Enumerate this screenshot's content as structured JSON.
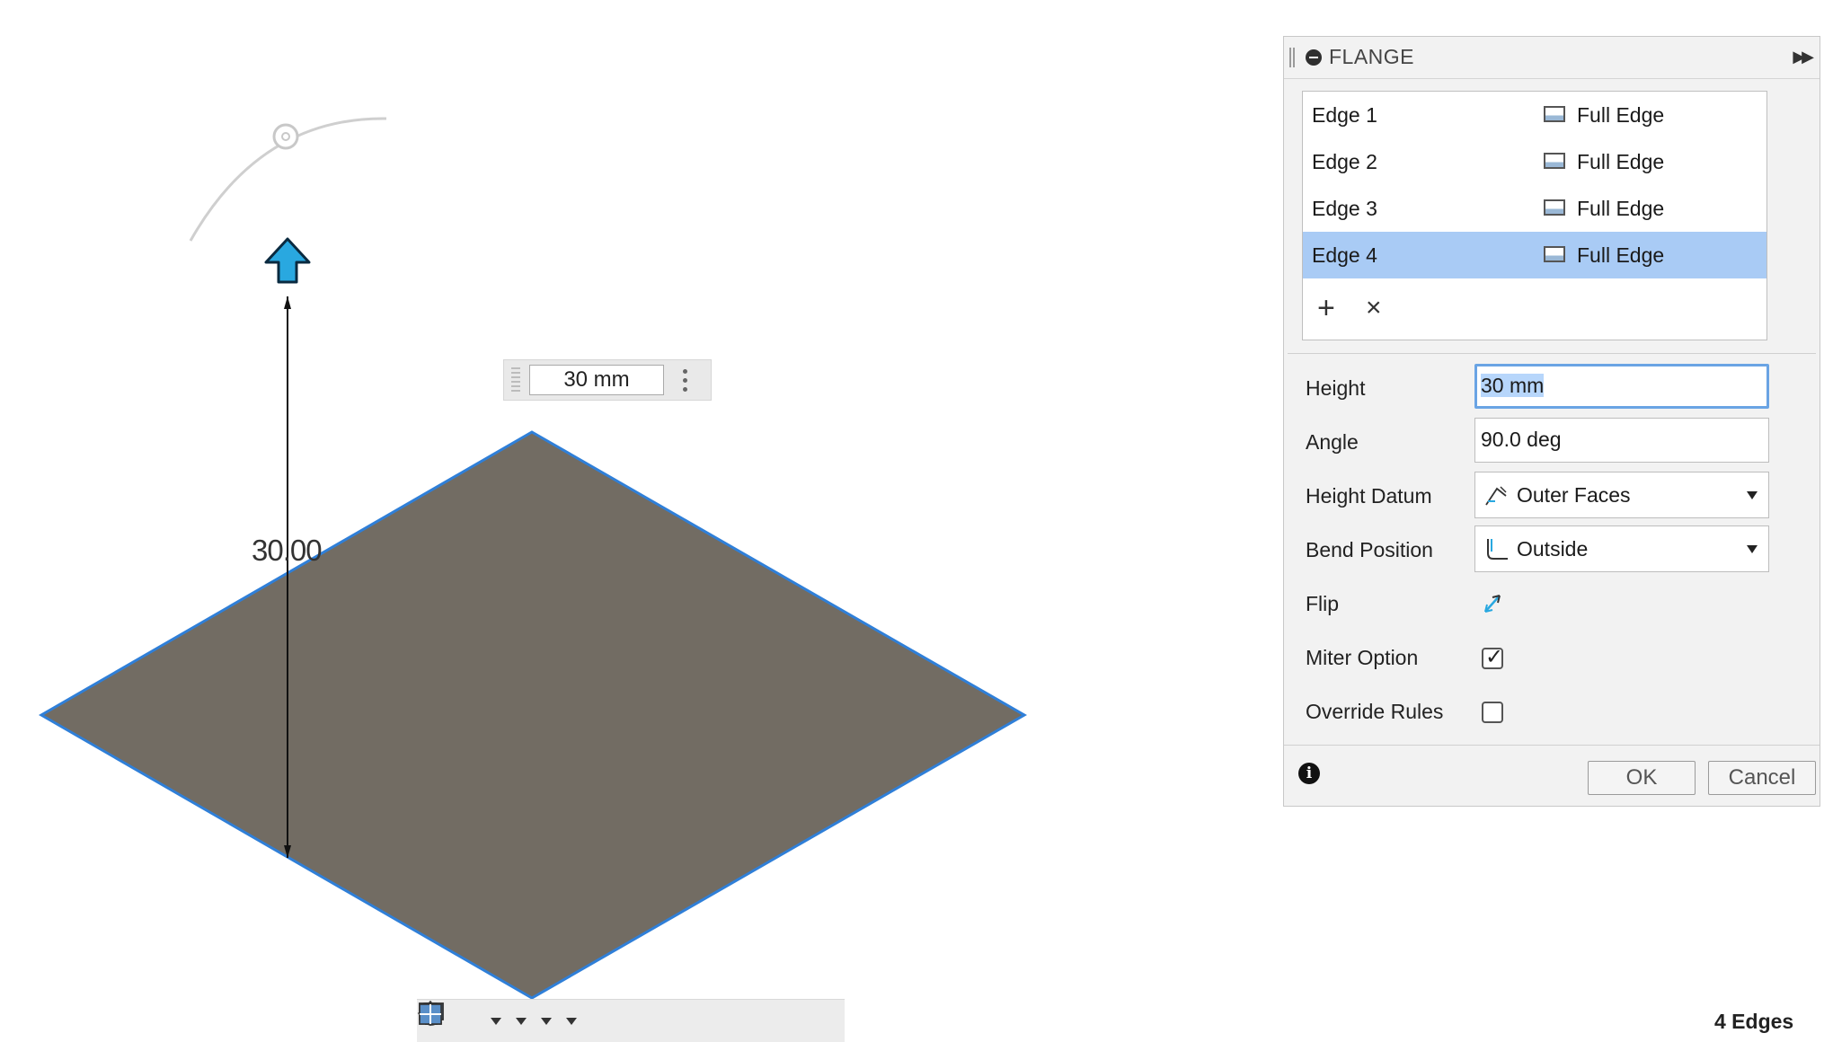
{
  "viewport": {
    "dimension_input": "30 mm",
    "dimension_label": "30.00"
  },
  "dialog": {
    "title": "FLANGE",
    "edges": [
      {
        "name": "Edge 1",
        "type": "Full Edge",
        "selected": false
      },
      {
        "name": "Edge 2",
        "type": "Full Edge",
        "selected": false
      },
      {
        "name": "Edge 3",
        "type": "Full Edge",
        "selected": false
      },
      {
        "name": "Edge 4",
        "type": "Full Edge",
        "selected": true
      }
    ],
    "add_symbol": "+",
    "remove_symbol": "×",
    "height": {
      "label": "Height",
      "value": "30 mm"
    },
    "angle": {
      "label": "Angle",
      "value": "90.0 deg"
    },
    "height_datum": {
      "label": "Height Datum",
      "value": "Outer Faces"
    },
    "bend_position": {
      "label": "Bend Position",
      "value": "Outside"
    },
    "flip": {
      "label": "Flip"
    },
    "miter_option": {
      "label": "Miter Option",
      "checked": true
    },
    "override_rules": {
      "label": "Override Rules",
      "checked": false
    },
    "info_symbol": "i",
    "ok_label": "OK",
    "cancel_label": "Cancel"
  },
  "status": {
    "text": "4 Edges"
  },
  "colors": {
    "plate": "#726c63",
    "edge_highlight": "#2f7fd8",
    "arrow": "#29a8e0",
    "selection": "#a9cbf5"
  },
  "icons": [
    "pan-icon",
    "orbit-icon",
    "hand-icon",
    "zoom-icon",
    "zoom-window-icon",
    "display-icon",
    "grid-icon",
    "viewports-icon",
    "flip-icon",
    "info-icon",
    "collapse-icon"
  ]
}
